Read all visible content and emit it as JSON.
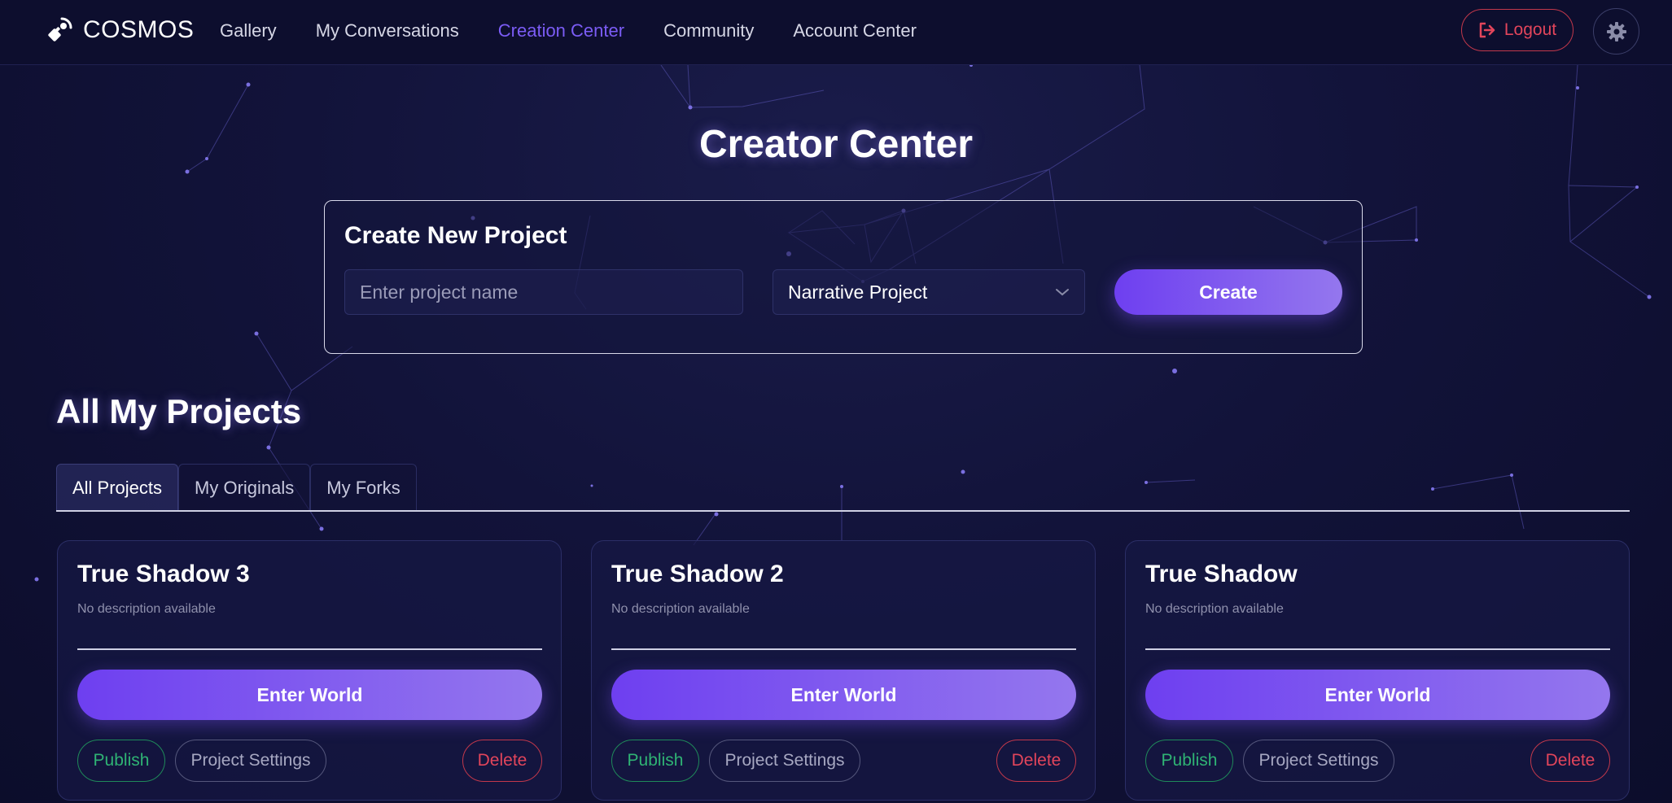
{
  "nav": {
    "brand": "COSMOS",
    "items": [
      {
        "label": "Gallery",
        "active": false
      },
      {
        "label": "My Conversations",
        "active": false
      },
      {
        "label": "Creation Center",
        "active": true
      },
      {
        "label": "Community",
        "active": false
      },
      {
        "label": "Account Center",
        "active": false
      }
    ],
    "logout_label": "Logout"
  },
  "page": {
    "title": "Creator Center"
  },
  "create_panel": {
    "heading": "Create New Project",
    "name_placeholder": "Enter project name",
    "name_value": "",
    "type_selected": "Narrative Project",
    "create_label": "Create"
  },
  "projects": {
    "title": "All My Projects",
    "tabs": [
      {
        "label": "All Projects",
        "active": true
      },
      {
        "label": "My Originals",
        "active": false
      },
      {
        "label": "My Forks",
        "active": false
      }
    ],
    "cards": [
      {
        "title": "True Shadow 3",
        "description": "No description available",
        "enter_label": "Enter World",
        "publish_label": "Publish",
        "settings_label": "Project Settings",
        "delete_label": "Delete"
      },
      {
        "title": "True Shadow 2",
        "description": "No description available",
        "enter_label": "Enter World",
        "publish_label": "Publish",
        "settings_label": "Project Settings",
        "delete_label": "Delete"
      },
      {
        "title": "True Shadow",
        "description": "No description available",
        "enter_label": "Enter World",
        "publish_label": "Publish",
        "settings_label": "Project Settings",
        "delete_label": "Delete"
      }
    ]
  },
  "icons": {
    "brand": "satellite-logo-icon",
    "logout": "logout-icon",
    "settings": "gear-icon",
    "select_caret": "chevron-down-icon"
  },
  "colors": {
    "accent": "#7b5cf5",
    "danger": "#e2455b",
    "success": "#2fb374",
    "background": "#12133a"
  }
}
